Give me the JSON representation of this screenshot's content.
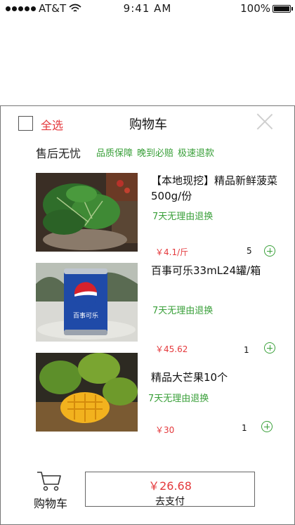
{
  "status_bar": {
    "carrier": "AT&T",
    "time": "9:41 AM",
    "battery": "100%",
    "battery_level": 1.0
  },
  "header": {
    "select_all": "全选",
    "title": "购物车",
    "close_icon": "close-icon"
  },
  "service": {
    "title": "售后无忧",
    "tags": [
      "品质保障",
      "晚到必赔",
      "极速退款"
    ]
  },
  "items": [
    {
      "name": "【本地现挖】精品新鲜菠菜500g/份",
      "policy": "7天无理由退换",
      "price": "￥4.1/斤",
      "quantity": "5"
    },
    {
      "name": "百事可乐33mL24罐/箱",
      "policy": "7天无理由退换",
      "price": "￥45.62",
      "quantity": "1"
    },
    {
      "name": "精品大芒果10个",
      "policy": "7天无理由退换",
      "price": "￥30",
      "quantity": "1"
    }
  ],
  "footer": {
    "cart_label": "购物车",
    "total": "￥26.68",
    "pay_label": "去支付"
  },
  "can_text": "百事可乐",
  "colors": {
    "accent_red": "#e4393c",
    "accent_green": "#3aa03a"
  }
}
